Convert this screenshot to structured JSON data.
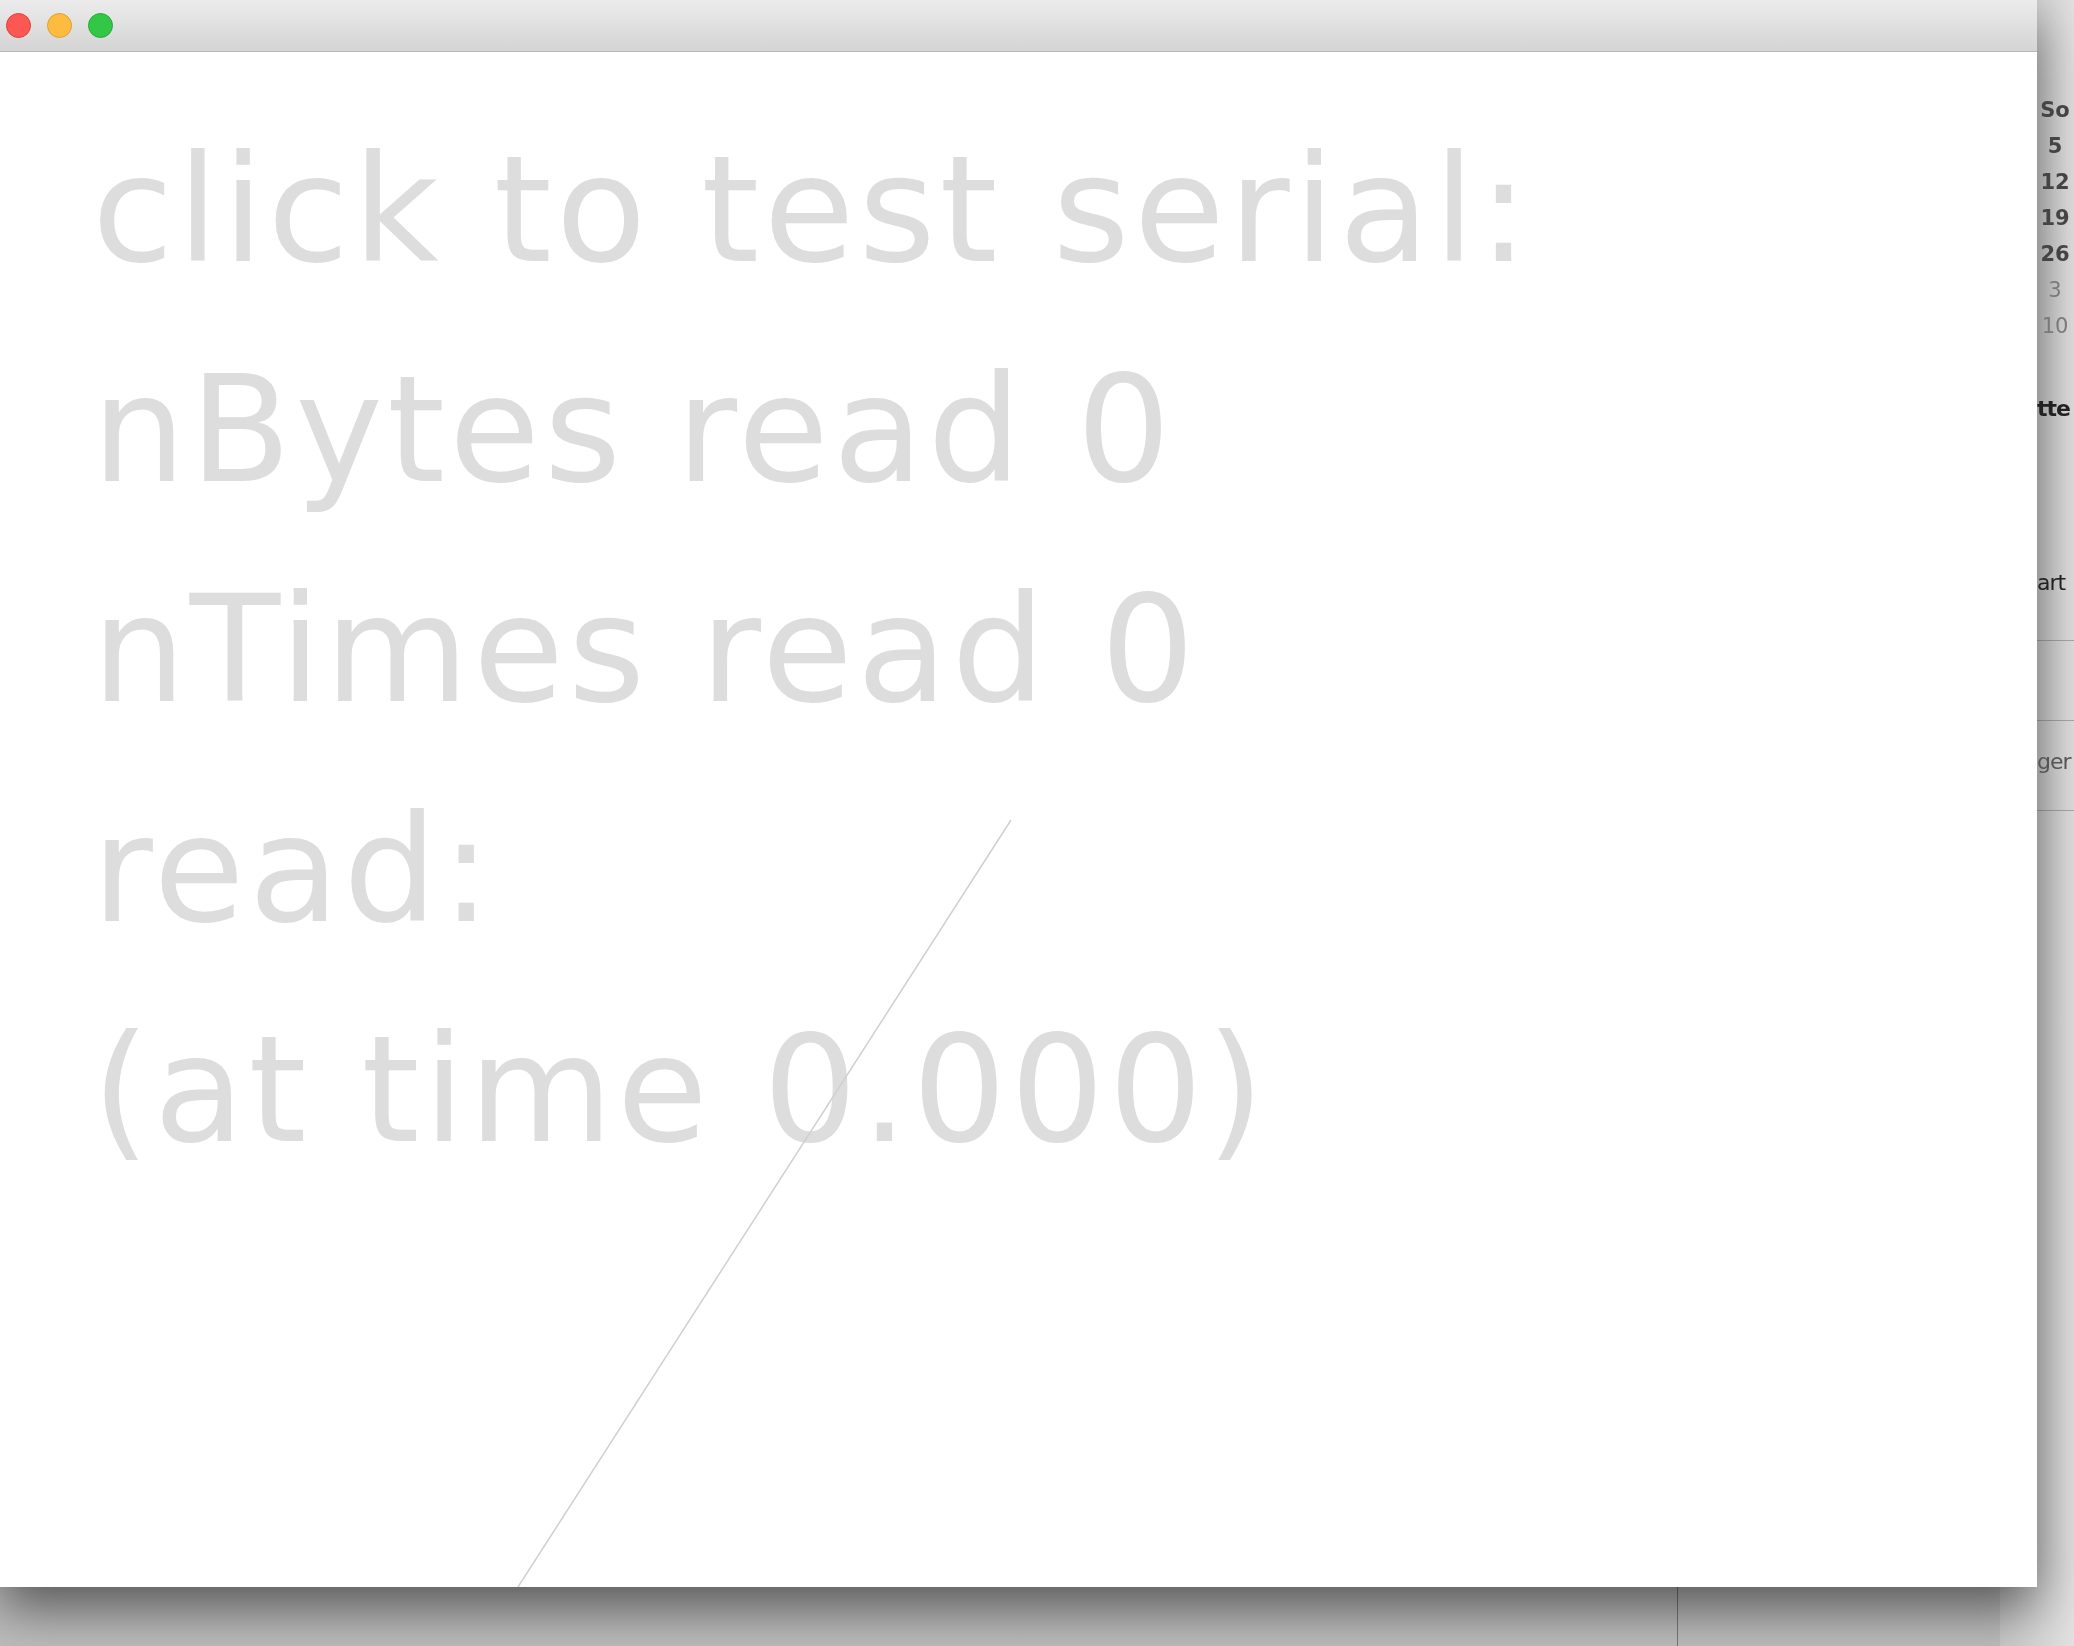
{
  "window": {
    "traffic_lights": [
      {
        "kind": "close"
      },
      {
        "kind": "minimize"
      },
      {
        "kind": "zoom"
      }
    ],
    "canvas": {
      "lines": [
        "click to test serial:",
        "nBytes read 0",
        "nTimes read 0",
        "read:",
        "(at time 0.000)"
      ]
    }
  },
  "background_window": {
    "calendar": {
      "header": "So",
      "days": [
        {
          "label": "5",
          "in_month": true
        },
        {
          "label": "12",
          "in_month": true
        },
        {
          "label": "19",
          "in_month": true
        },
        {
          "label": "26",
          "in_month": true
        },
        {
          "label": "3",
          "in_month": false
        },
        {
          "label": "10",
          "in_month": false
        }
      ]
    },
    "texts": [
      {
        "text": "tte",
        "kind": "heading"
      },
      {
        "text": "art",
        "kind": "label"
      },
      {
        "text": "ger",
        "kind": "placeholder"
      }
    ]
  }
}
